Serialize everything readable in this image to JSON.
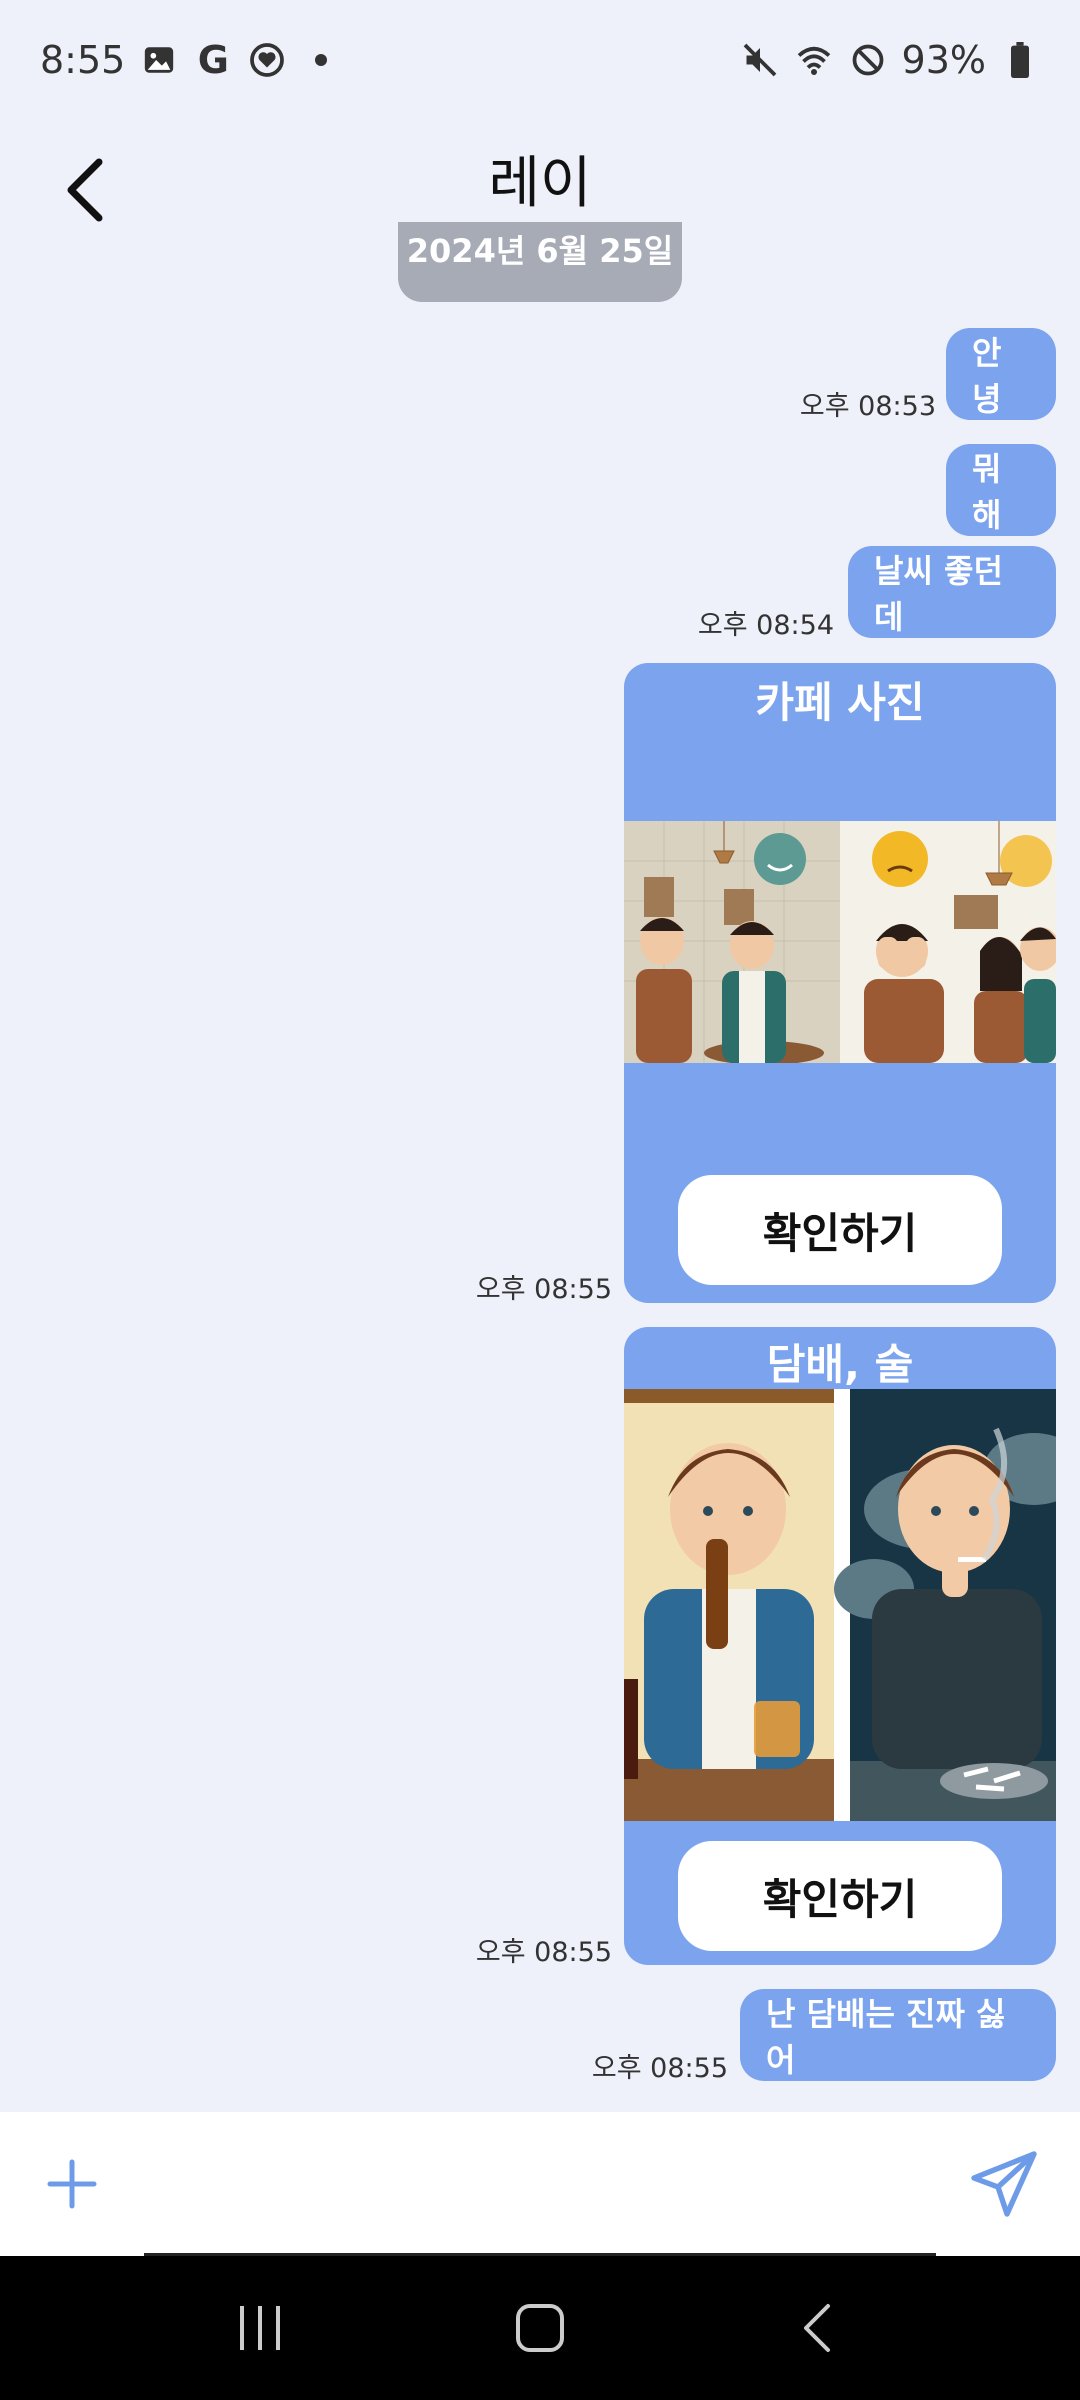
{
  "status": {
    "time": "8:55",
    "battery": "93%",
    "icons_left": [
      "gallery-icon",
      "google-icon",
      "heart-badge-icon",
      "dot-icon"
    ],
    "icons_right": [
      "mute-icon",
      "wifi-icon",
      "blocked-icon",
      "battery-icon"
    ]
  },
  "header": {
    "title": "레이",
    "date_chip": "2024년 6월 25일"
  },
  "messages": [
    {
      "text": "안녕",
      "time": ""
    },
    {
      "text": "",
      "time": "오후 08:53"
    },
    {
      "text": "뭐해",
      "time": ""
    },
    {
      "text": "날씨 좋던데",
      "time": "오후 08:54"
    }
  ],
  "cards": [
    {
      "title": "카페 사진",
      "button": "확인하기",
      "time": "오후 08:55"
    },
    {
      "title": "담배, 술",
      "button": "확인하기",
      "time": "오후 08:55"
    }
  ],
  "last_message": {
    "text": "난 담배는 진짜 싫어",
    "time": "오후 08:55"
  },
  "colors": {
    "bubble": "#7ca3ee",
    "background": "#eef0fa",
    "accent": "#6e9be8"
  }
}
